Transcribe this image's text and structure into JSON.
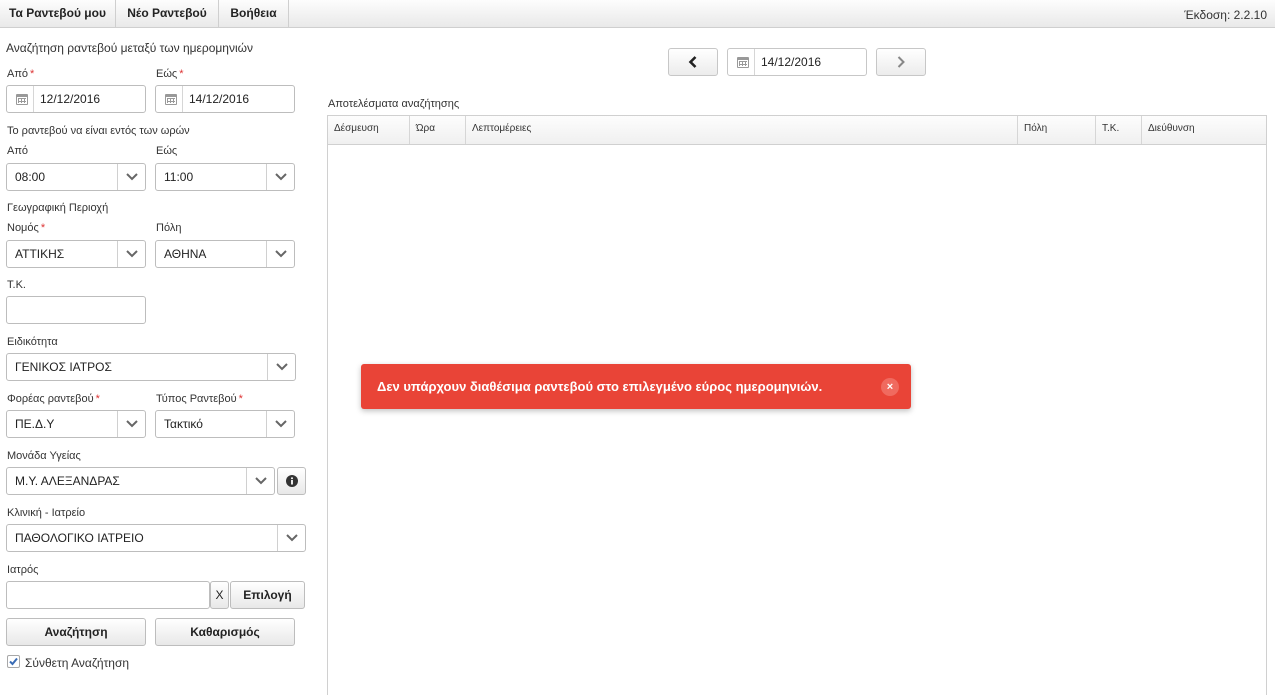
{
  "menu": {
    "items": [
      "Τα Ραντεβού μου",
      "Νέο Ραντεβού",
      "Βοήθεια"
    ],
    "version": "Έκδοση: 2.2.10"
  },
  "search": {
    "heading": "Αναζήτηση ραντεβού μεταξύ των ημερομηνιών",
    "from_label": "Από",
    "to_label": "Εώς",
    "from_date": "12/12/2016",
    "to_date": "14/12/2016",
    "hours_heading": "Το ραντεβού να είναι εντός των ωρών",
    "hours_from_label": "Από",
    "hours_to_label": "Εώς",
    "hours_from": "08:00",
    "hours_to": "11:00",
    "geo_heading": "Γεωγραφική Περιοχή",
    "prefecture_label": "Νομός",
    "prefecture": "ΑΤΤΙΚΗΣ",
    "city_label": "Πόλη",
    "city": "ΑΘΗΝΑ",
    "zip_label": "Τ.Κ.",
    "zip": "",
    "specialty_label": "Ειδικότητα",
    "specialty": "ΓΕΝΙΚΟΣ ΙΑΤΡΟΣ",
    "agency_label": "Φορέας ραντεβού",
    "agency": "ΠΕ.Δ.Υ",
    "type_label": "Τύπος Ραντεβού",
    "type": "Τακτικό",
    "unit_label": "Μονάδα Υγείας",
    "unit": "Μ.Υ. ΑΛΕΞΑΝΔΡΑΣ",
    "clinic_label": "Κλινική - Ιατρείο",
    "clinic": "ΠΑΘΟΛΟΓΙΚΟ ΙΑΤΡΕΙΟ",
    "doctor_label": "Ιατρός",
    "doctor": "",
    "clear_x_label": "X",
    "select_label": "Επιλογή",
    "search_button": "Αναζήτηση",
    "reset_button": "Καθαρισμός",
    "advanced_label": "Σύνθετη Αναζήτηση",
    "advanced_checked": true,
    "required_mark": "*"
  },
  "results": {
    "current_date": "14/12/2016",
    "title": "Αποτελέσματα αναζήτησης",
    "columns": [
      "Δέσμευση",
      "Ώρα",
      "Λεπτομέρειες",
      "Πόλη",
      "Τ.Κ.",
      "Διεύθυνση"
    ]
  },
  "toast": {
    "message": "Δεν υπάρχουν διαθέσιμα ραντεβού στο επιλεγμένο εύρος ημερομηνιών.",
    "close_label": "×",
    "color": "#e94437"
  }
}
